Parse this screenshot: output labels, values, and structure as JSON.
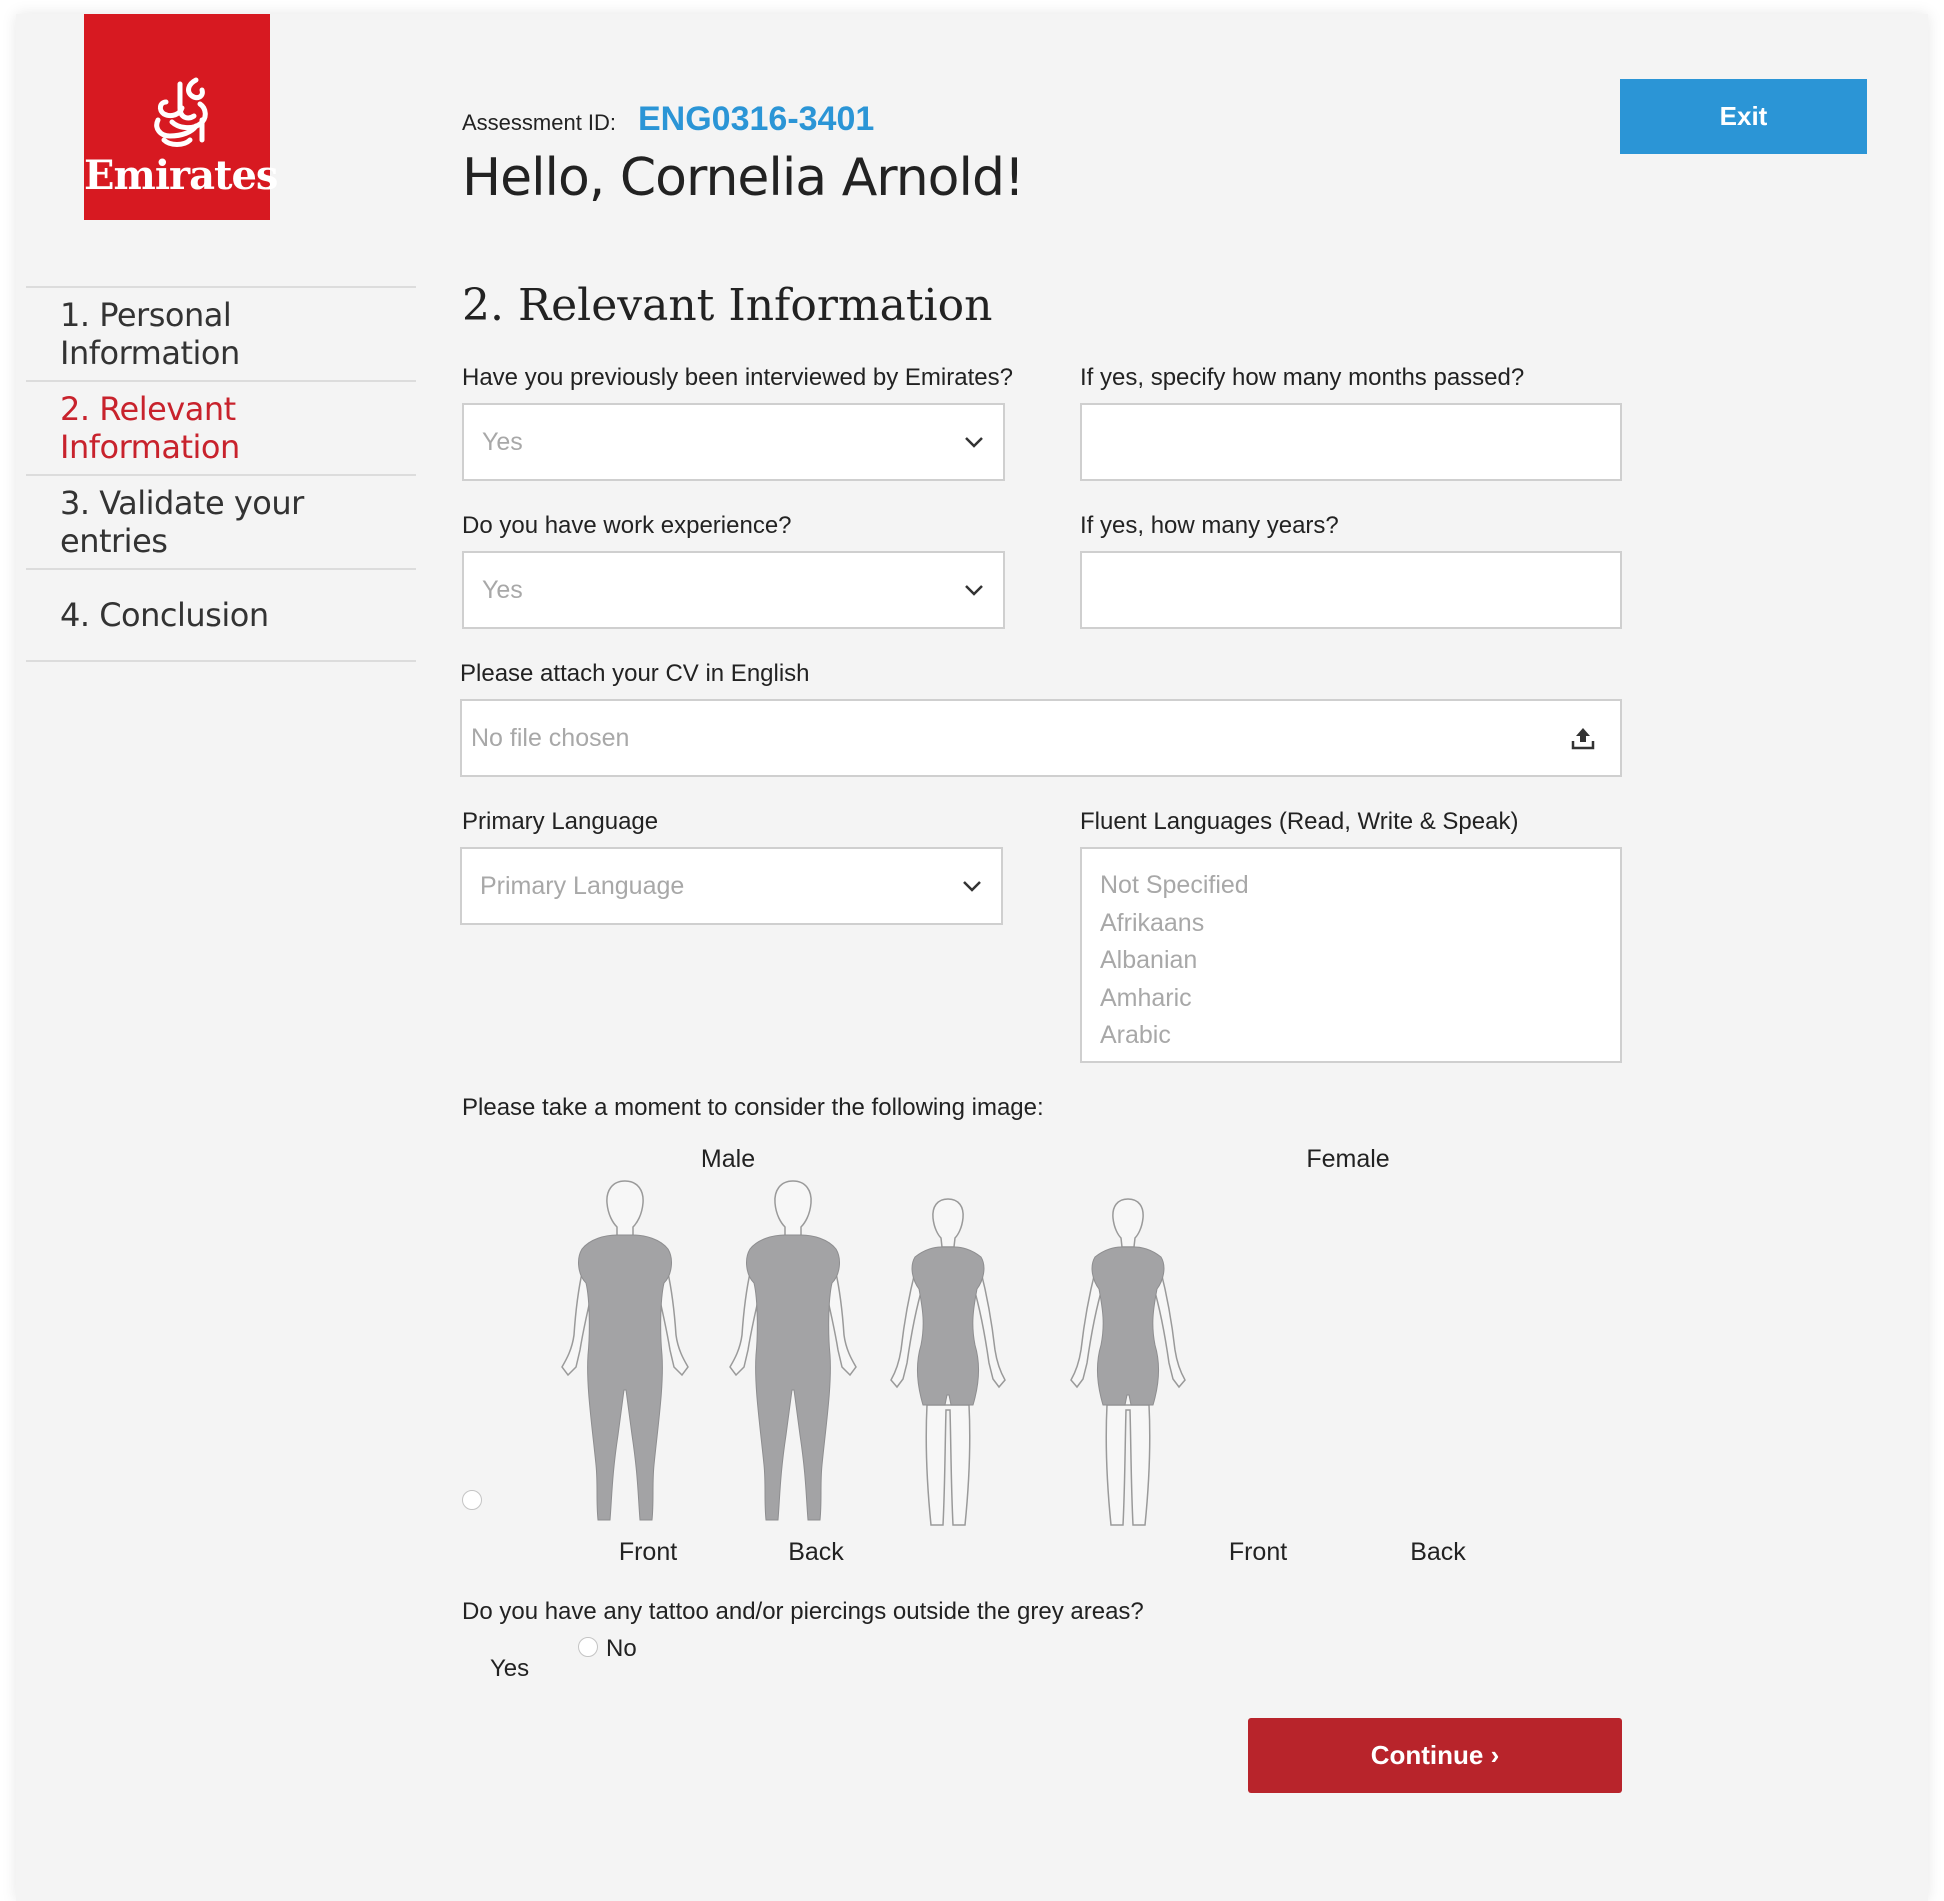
{
  "brand": {
    "name": "Emirates",
    "color": "#d71921"
  },
  "header": {
    "assessment_label": "Assessment ID:",
    "assessment_id": "ENG0316-3401",
    "greeting": "Hello, Cornelia Arnold!",
    "exit_label": "Exit"
  },
  "sidebar": {
    "items": [
      {
        "label": "1. Personal Information",
        "active": false
      },
      {
        "label": "2. Relevant Information",
        "active": true
      },
      {
        "label": "3. Validate your entries",
        "active": false
      },
      {
        "label": "4. Conclusion",
        "active": false
      }
    ]
  },
  "form": {
    "section_title": "2. Relevant Information",
    "interviewed": {
      "label": "Have you previously been interviewed by Emirates?",
      "value": "Yes"
    },
    "months_passed": {
      "label": "If yes, specify how many months passed?",
      "value": ""
    },
    "work_experience": {
      "label": "Do you have work experience?",
      "value": "Yes"
    },
    "years": {
      "label": "If yes, how many years?",
      "value": ""
    },
    "cv": {
      "label": "Please attach your CV in English",
      "placeholder": "No file chosen"
    },
    "primary_language": {
      "label": "Primary Language",
      "placeholder": "Primary Language"
    },
    "fluent_languages": {
      "label": "Fluent Languages (Read, Write & Speak)",
      "options": [
        "Not Specified",
        "Afrikaans",
        "Albanian",
        "Amharic",
        "Arabic"
      ]
    },
    "image_prompt": "Please take a moment to consider the following image:",
    "figures": {
      "male_label": "Male",
      "female_label": "Female",
      "front_label": "Front",
      "back_label": "Back"
    },
    "tattoo": {
      "question": "Do you have any tattoo and/or piercings outside the grey areas?",
      "yes_label": "Yes",
      "no_label": "No"
    },
    "continue_label": "Continue ›"
  },
  "colors": {
    "accent_blue": "#2b95d6",
    "accent_red": "#c8222c",
    "continue_red": "#b8242b",
    "body_grey": "#a3a3a5"
  }
}
